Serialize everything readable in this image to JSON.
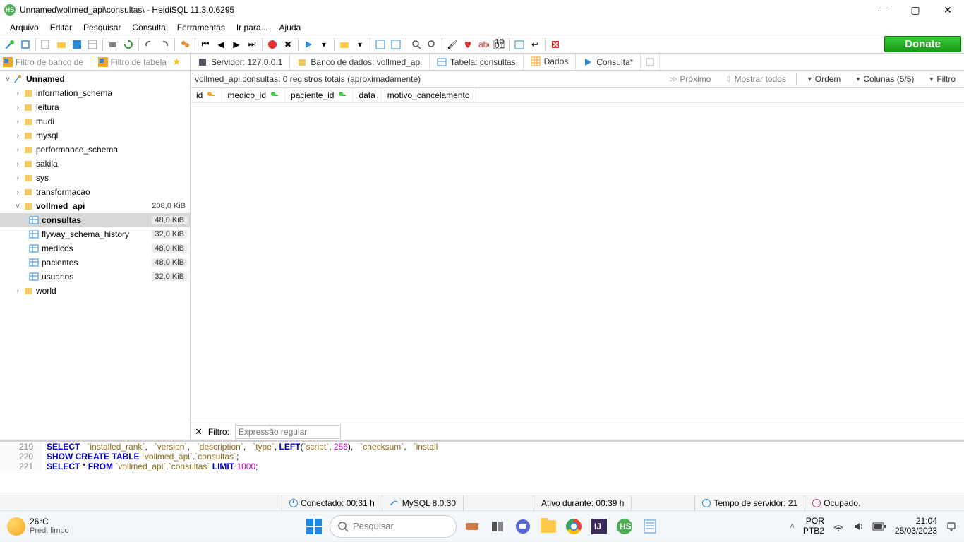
{
  "window": {
    "title": "Unnamed\\vollmed_api\\consultas\\ - HeidiSQL 11.3.0.6295"
  },
  "menus": [
    "Arquivo",
    "Editar",
    "Pesquisar",
    "Consulta",
    "Ferramentas",
    "Ir para...",
    "Ajuda"
  ],
  "donate": "Donate",
  "filters": {
    "db": "Filtro de banco de",
    "table": "Filtro de tabela"
  },
  "tabs": {
    "host": "Servidor: 127.0.0.1",
    "database": "Banco de dados: vollmed_api",
    "table": "Tabela: consultas",
    "data": "Dados",
    "query": "Consulta*"
  },
  "tree": {
    "root": "Unnamed",
    "dbs": [
      "information_schema",
      "leitura",
      "mudi",
      "mysql",
      "performance_schema",
      "sakila",
      "sys",
      "transformacao"
    ],
    "active_db": "vollmed_api",
    "active_db_size": "208,0 KiB",
    "tables": [
      {
        "name": "consultas",
        "size": "48,0 KiB",
        "selected": true
      },
      {
        "name": "flyway_schema_history",
        "size": "32,0 KiB"
      },
      {
        "name": "medicos",
        "size": "48,0 KiB"
      },
      {
        "name": "pacientes",
        "size": "48,0 KiB"
      },
      {
        "name": "usuarios",
        "size": "32,0 KiB"
      }
    ],
    "last_db": "world"
  },
  "data_summary": "vollmed_api.consultas: 0 registros totais (aproximadamente)",
  "data_controls": {
    "next": "Próximo",
    "showall": "Mostrar todos",
    "order": "Ordem",
    "columns": "Colunas (5/5)",
    "filter": "Filtro"
  },
  "columns": [
    {
      "name": "id",
      "key": "pk"
    },
    {
      "name": "medico_id",
      "key": "fk"
    },
    {
      "name": "paciente_id",
      "key": "fk"
    },
    {
      "name": "data",
      "key": null
    },
    {
      "name": "motivo_cancelamento",
      "key": null
    }
  ],
  "filter_footer": {
    "label": "Filtro:",
    "placeholder": "Expressão regular"
  },
  "sql_log": [
    {
      "n": "219",
      "tokens": [
        [
          "kw",
          "SELECT"
        ],
        [
          "punct",
          "   "
        ],
        [
          "ident",
          "`installed_rank`"
        ],
        [
          "punct",
          ",   "
        ],
        [
          "ident",
          "`version`"
        ],
        [
          "punct",
          ",   "
        ],
        [
          "ident",
          "`description`"
        ],
        [
          "punct",
          ",   "
        ],
        [
          "ident",
          "`type`"
        ],
        [
          "punct",
          ", "
        ],
        [
          "func",
          "LEFT"
        ],
        [
          "punct",
          "("
        ],
        [
          "ident",
          "`script`"
        ],
        [
          "punct",
          ", "
        ],
        [
          "num",
          "256"
        ],
        [
          "punct",
          "),   "
        ],
        [
          "ident",
          "`checksum`"
        ],
        [
          "punct",
          ",   "
        ],
        [
          "ident",
          "`install"
        ]
      ]
    },
    {
      "n": "220",
      "tokens": [
        [
          "kw",
          "SHOW CREATE TABLE"
        ],
        [
          "punct",
          " "
        ],
        [
          "ident",
          "`vollmed_api`"
        ],
        [
          "punct",
          "."
        ],
        [
          "ident",
          "`consultas`"
        ],
        [
          "punct",
          ";"
        ]
      ]
    },
    {
      "n": "221",
      "tokens": [
        [
          "kw",
          "SELECT"
        ],
        [
          "punct",
          " * "
        ],
        [
          "kw",
          "FROM"
        ],
        [
          "punct",
          " "
        ],
        [
          "ident",
          "`vollmed_api`"
        ],
        [
          "punct",
          "."
        ],
        [
          "ident",
          "`consultas`"
        ],
        [
          "punct",
          " "
        ],
        [
          "kw",
          "LIMIT"
        ],
        [
          "punct",
          " "
        ],
        [
          "num",
          "1000"
        ],
        [
          "punct",
          ";"
        ]
      ]
    }
  ],
  "statusbar": {
    "connected": "Conectado: 00:31 h",
    "mysql": "MySQL 8.0.30",
    "active": "Ativo durante: 00:39 h",
    "servertime": "Tempo de servidor: 21",
    "busy": "Ocupado."
  },
  "taskbar": {
    "temp": "26°C",
    "weather": "Pred. limpo",
    "search": "Pesquisar",
    "lang1": "POR",
    "lang2": "PTB2",
    "time": "21:04",
    "date": "25/03/2023"
  }
}
